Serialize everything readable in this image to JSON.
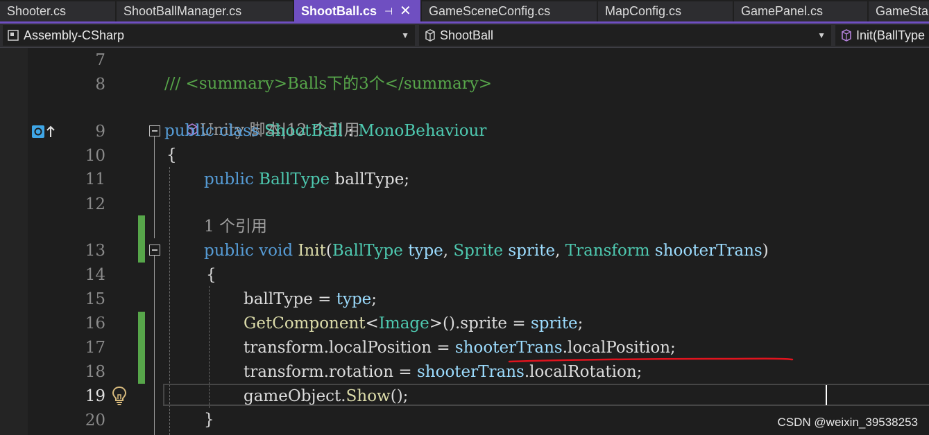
{
  "tabs": [
    {
      "label": "Shooter.cs"
    },
    {
      "label": "ShootBallManager.cs"
    },
    {
      "label": "ShootBall.cs",
      "active": true,
      "pin": "⊣",
      "close": "✕"
    },
    {
      "label": "GameSceneConfig.cs"
    },
    {
      "label": "MapConfig.cs"
    },
    {
      "label": "GamePanel.cs"
    },
    {
      "label": "GameSta"
    }
  ],
  "navbar": {
    "project": "Assembly-CSharp",
    "type": "ShootBall",
    "member": "Init(BallType"
  },
  "code": {
    "line_numbers": [
      "7",
      "8",
      "9",
      "10",
      "11",
      "12",
      "13",
      "14",
      "15",
      "16",
      "17",
      "18",
      "19",
      "20"
    ],
    "current_line": "19",
    "summary": "/// <summary>Balls下的3个</summary>",
    "lens_class": "Unity 脚本|12 个引用",
    "lens_init": "1 个引用",
    "l9": {
      "kw1": "public",
      "kw2": "class",
      "name": "ShootBall",
      "colon": " : ",
      "base": "MonoBehaviour"
    },
    "l10": "{",
    "l11": {
      "kw": "public",
      "type": "BallType",
      "rest": " ballType;"
    },
    "l13": {
      "kw1": "public",
      "kw2": "void",
      "method": "Init",
      "p1t": "BallType",
      "p1": "type",
      "p2t": "Sprite",
      "p2": "sprite",
      "p3t": "Transform",
      "p3": "shooterTrans"
    },
    "l14": "{",
    "l15": {
      "lhs": "ballType = ",
      "rhs": "type",
      "end": ";"
    },
    "l16": {
      "m": "GetComponent",
      "lt": "<",
      "t": "Image",
      "gt": ">().sprite = ",
      "v": "sprite",
      "end": ";"
    },
    "l17": {
      "lhs": "transform.localPosition = ",
      "v": "shooterTrans",
      "rest": ".localPosition;"
    },
    "l18": {
      "lhs": "transform.rotation = ",
      "v": "shooterTrans",
      "rest": ".localRotation;"
    },
    "l19": {
      "lhs": "gameObject.",
      "m": "Show",
      "rest": "();"
    },
    "l20": "}"
  },
  "watermark": "CSDN @weixin_39538253"
}
